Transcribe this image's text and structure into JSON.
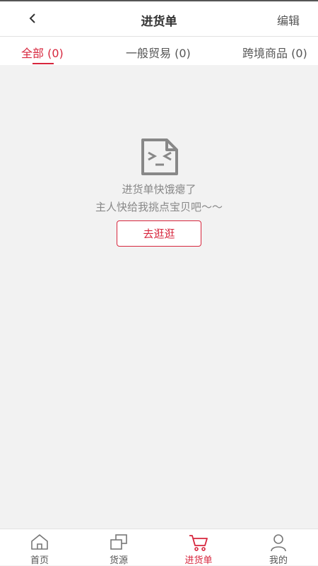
{
  "header": {
    "title": "进货单",
    "edit_label": "编辑"
  },
  "tabs": [
    {
      "label": "全部 (0)",
      "active": true
    },
    {
      "label": "一般贸易 (0)",
      "active": false
    },
    {
      "label": "跨境商品 (0)",
      "active": false
    }
  ],
  "empty_state": {
    "icon": "empty-document-face-icon",
    "message_line1": "进货单快饿瘪了",
    "message_line2": "主人快给我挑点宝贝吧～～",
    "button_label": "去逛逛"
  },
  "bottom_nav": [
    {
      "label": "首页",
      "icon": "home-icon",
      "active": false
    },
    {
      "label": "货源",
      "icon": "stack-icon",
      "active": false
    },
    {
      "label": "进货单",
      "icon": "cart-icon",
      "active": true
    },
    {
      "label": "我的",
      "icon": "user-icon",
      "active": false
    }
  ],
  "colors": {
    "accent": "#d7263d",
    "background": "#f2f2f2",
    "muted_text": "#888888"
  }
}
